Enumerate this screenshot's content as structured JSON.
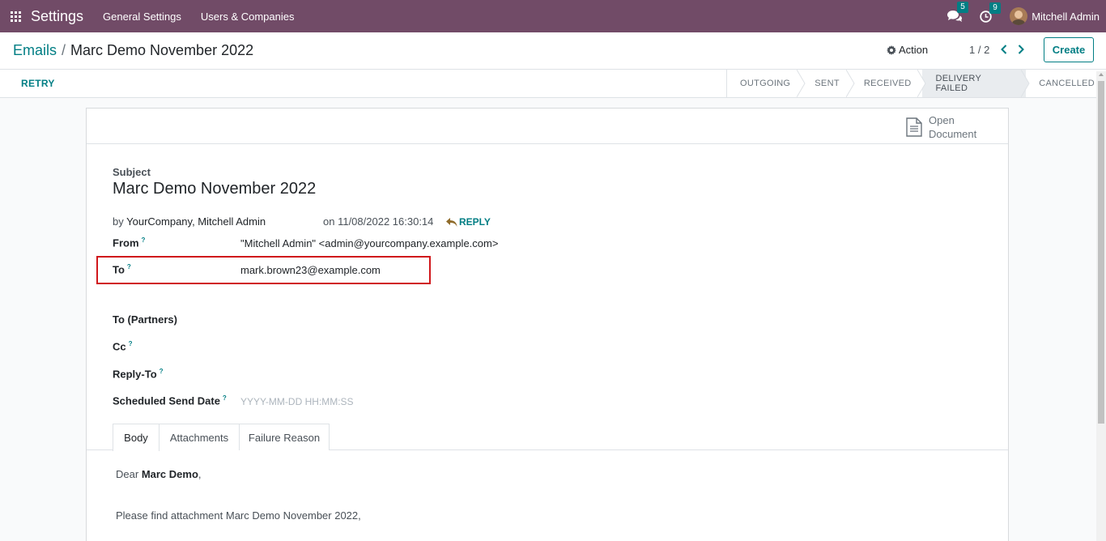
{
  "navbar": {
    "app_title": "Settings",
    "menu": [
      "General Settings",
      "Users & Companies"
    ],
    "messages_count": "5",
    "activities_count": "9",
    "user_name": "Mitchell Admin"
  },
  "control_panel": {
    "breadcrumb_parent": "Emails",
    "breadcrumb_separator": "/",
    "breadcrumb_current": "Marc Demo November 2022",
    "action_label": "Action",
    "pager_value": "1 / 2",
    "create_label": "Create"
  },
  "statusbar": {
    "retry_label": "RETRY",
    "stages": [
      {
        "label": "OUTGOING",
        "active": false
      },
      {
        "label": "SENT",
        "active": false
      },
      {
        "label": "RECEIVED",
        "active": false
      },
      {
        "label": "DELIVERY FAILED",
        "active": true
      },
      {
        "label": "CANCELLED",
        "active": false
      }
    ]
  },
  "sheet": {
    "open_document_line1": "Open",
    "open_document_line2": "Document",
    "subject_label": "Subject",
    "subject_value": "Marc Demo November 2022",
    "by_prefix": "by",
    "by_author": "YourCompany, Mitchell Admin",
    "date_text": "on 11/08/2022 16:30:14",
    "reply_label": "REPLY",
    "fields": {
      "from_label": "From",
      "from_value": "\"Mitchell Admin\" <admin@yourcompany.example.com>",
      "to_label": "To",
      "to_value": "mark.brown23@example.com",
      "to_partners_label": "To (Partners)",
      "cc_label": "Cc",
      "reply_to_label": "Reply-To",
      "scheduled_label": "Scheduled Send Date",
      "scheduled_placeholder": "YYYY-MM-DD HH:MM:SS",
      "help_marker": "?"
    },
    "tabs": [
      "Body",
      "Attachments",
      "Failure Reason"
    ],
    "body": {
      "greeting_prefix": "Dear",
      "greeting_name": "Marc Demo",
      "greeting_suffix": ",",
      "line2": "Please find attachment Marc Demo November 2022,"
    }
  }
}
